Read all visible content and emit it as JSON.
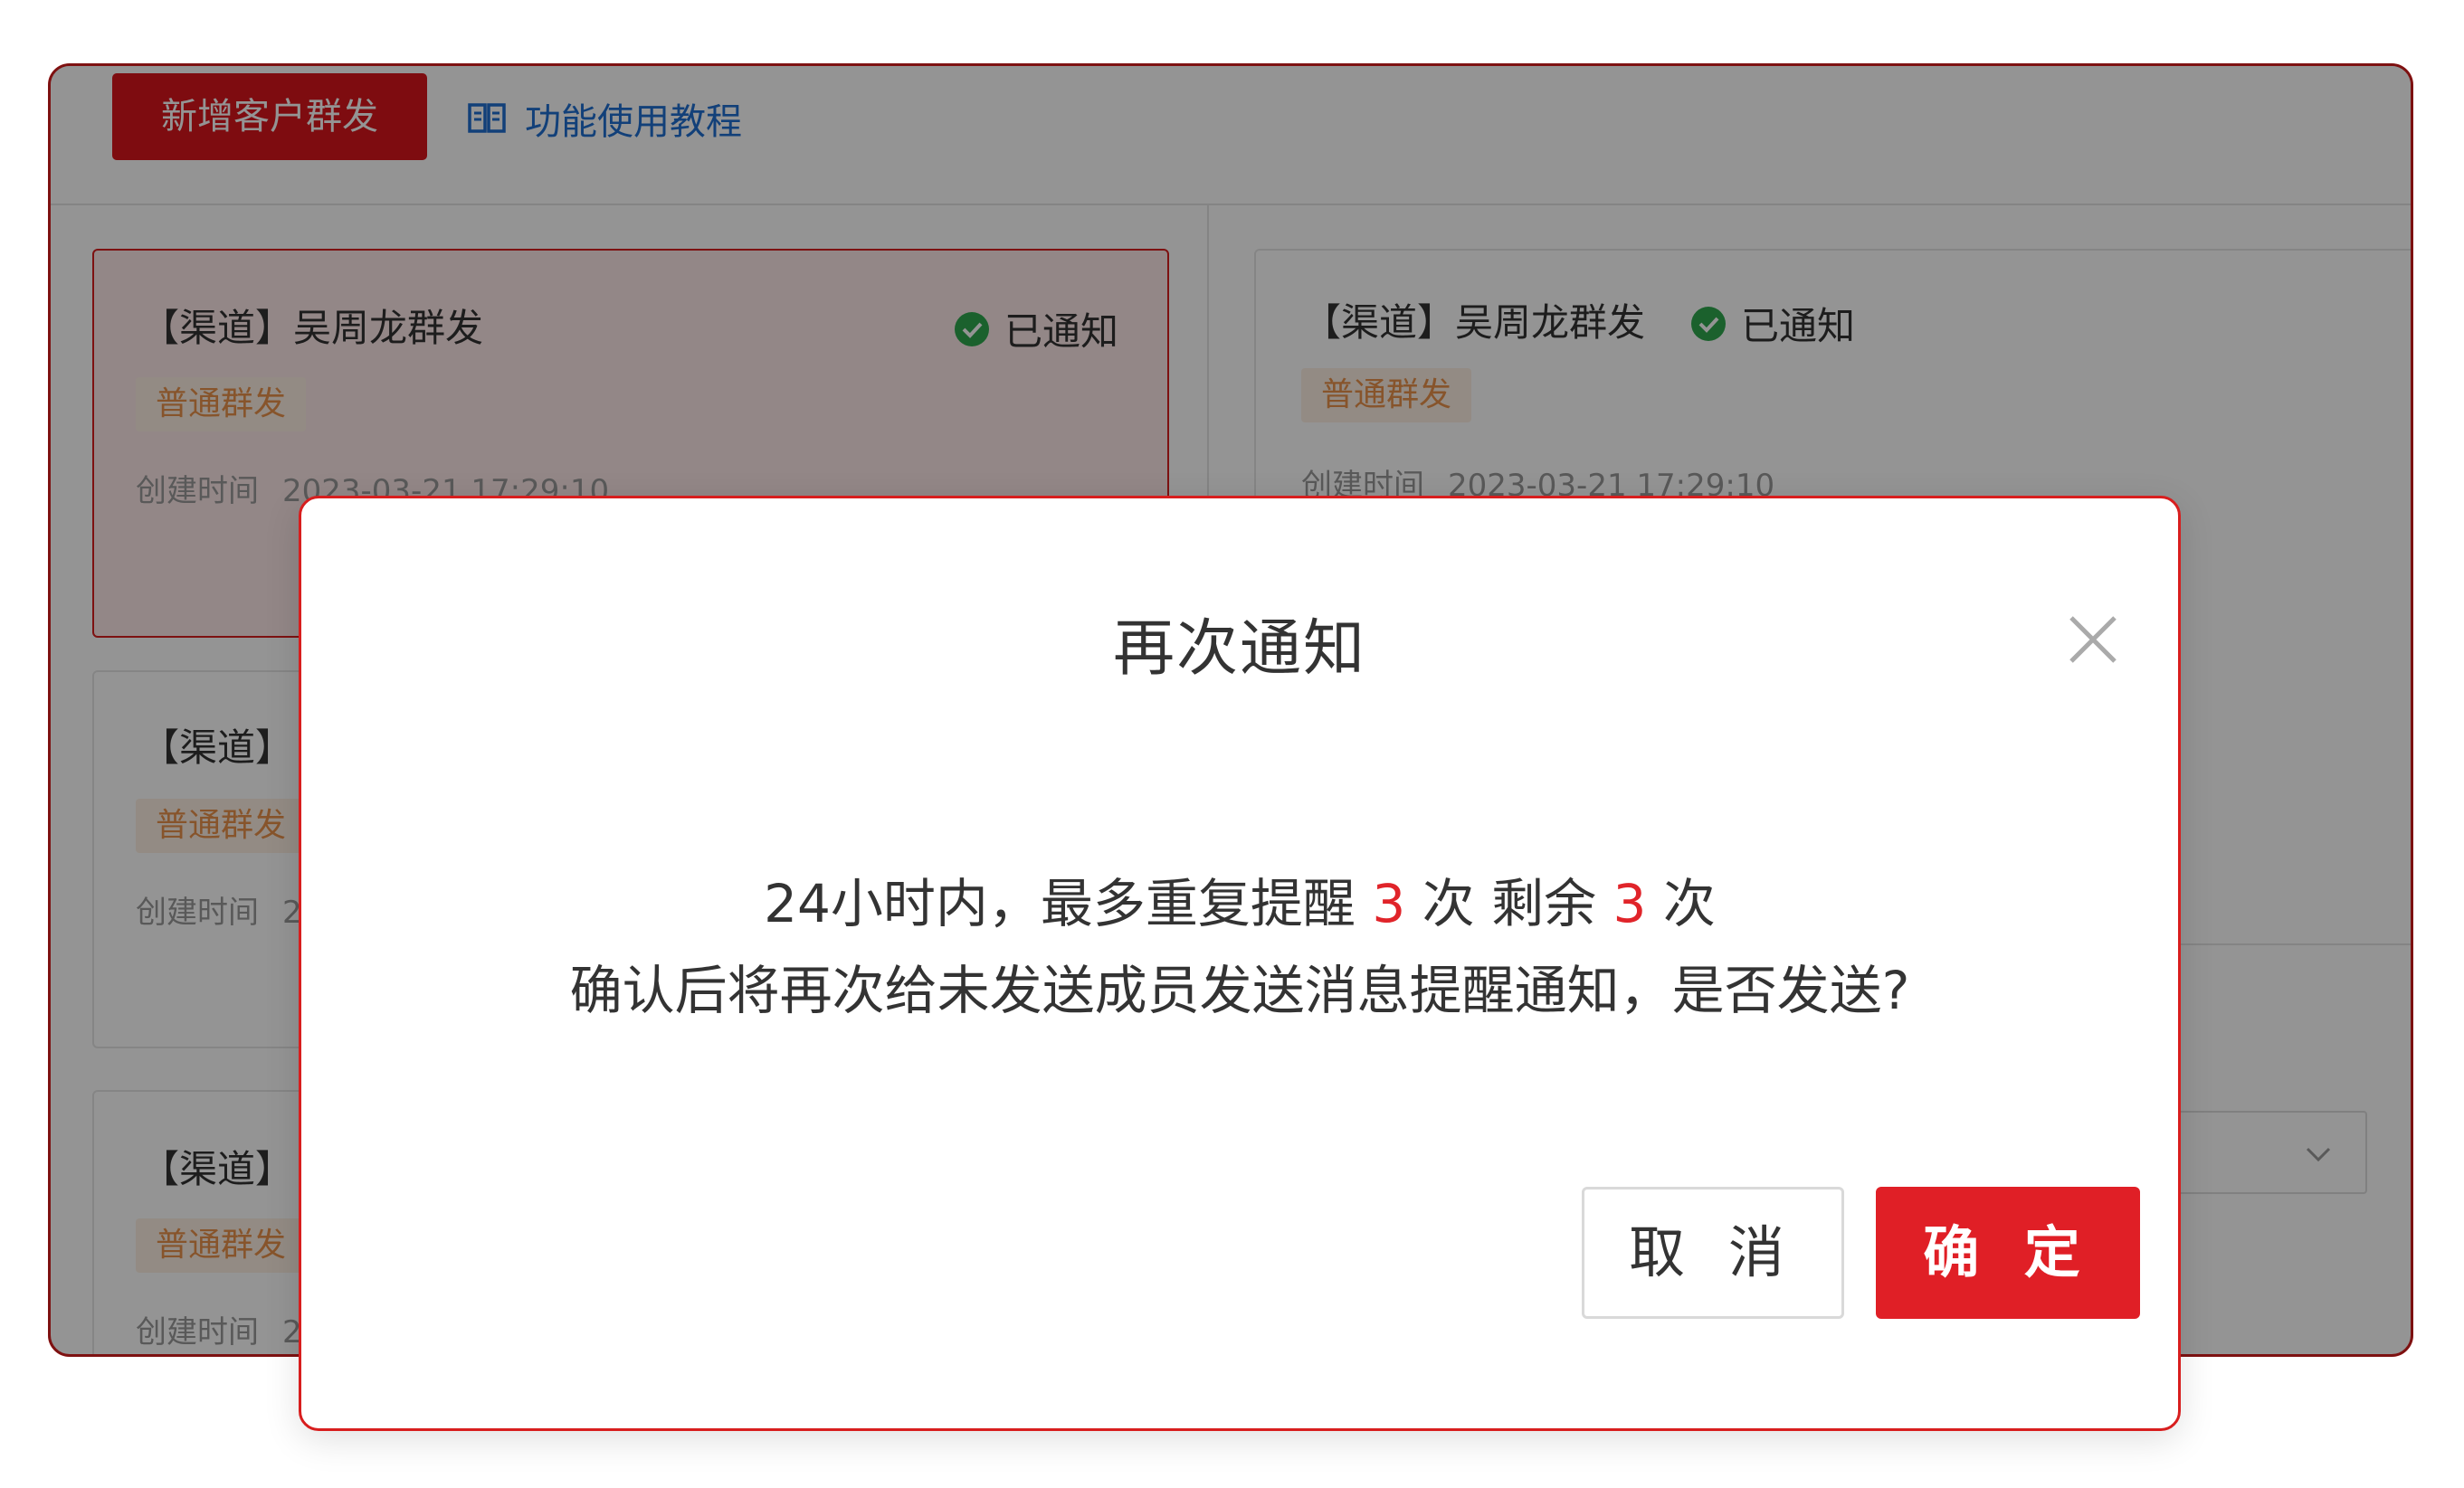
{
  "toolbar": {
    "new_button_label": "新增客户群发",
    "tutorial_label": "功能使用教程",
    "tutorial_icon": "book-icon"
  },
  "cards": [
    {
      "title": "【渠道】吴周龙群发",
      "status": "已通知",
      "tag": "普通群发",
      "created_label": "创建时间",
      "created_time": "2023-03-21 17:29:10"
    },
    {
      "title": "【渠道】吴周龙群发",
      "status": "已通知",
      "tag": "普通群发",
      "created_label": "创建时间",
      "created_time": "2023-03-21 17:29:10"
    },
    {
      "title": "【渠道】",
      "tag": "普通群发",
      "created_label": "创建时间",
      "created_time": "2"
    },
    {
      "title": "【渠道】",
      "tag": "普通群发",
      "created_label": "创建时间",
      "created_time": "2"
    }
  ],
  "modal": {
    "title": "再次通知",
    "close_icon": "close-icon",
    "line1_prefix": "24小时内，最多重复提醒",
    "max_count": "3",
    "line1_mid": "次 剩余",
    "remaining_count": "3",
    "line1_suffix": "次",
    "line2": "确认后将再次给未发送成员发送消息提醒通知，是否发送?",
    "cancel_label": "取 消",
    "confirm_label": "确 定"
  },
  "colors": {
    "brand_red": "#d9161d",
    "link_blue": "#1f6fd0",
    "success_green": "#2fa84f",
    "tag_orange": "#e8924a"
  }
}
